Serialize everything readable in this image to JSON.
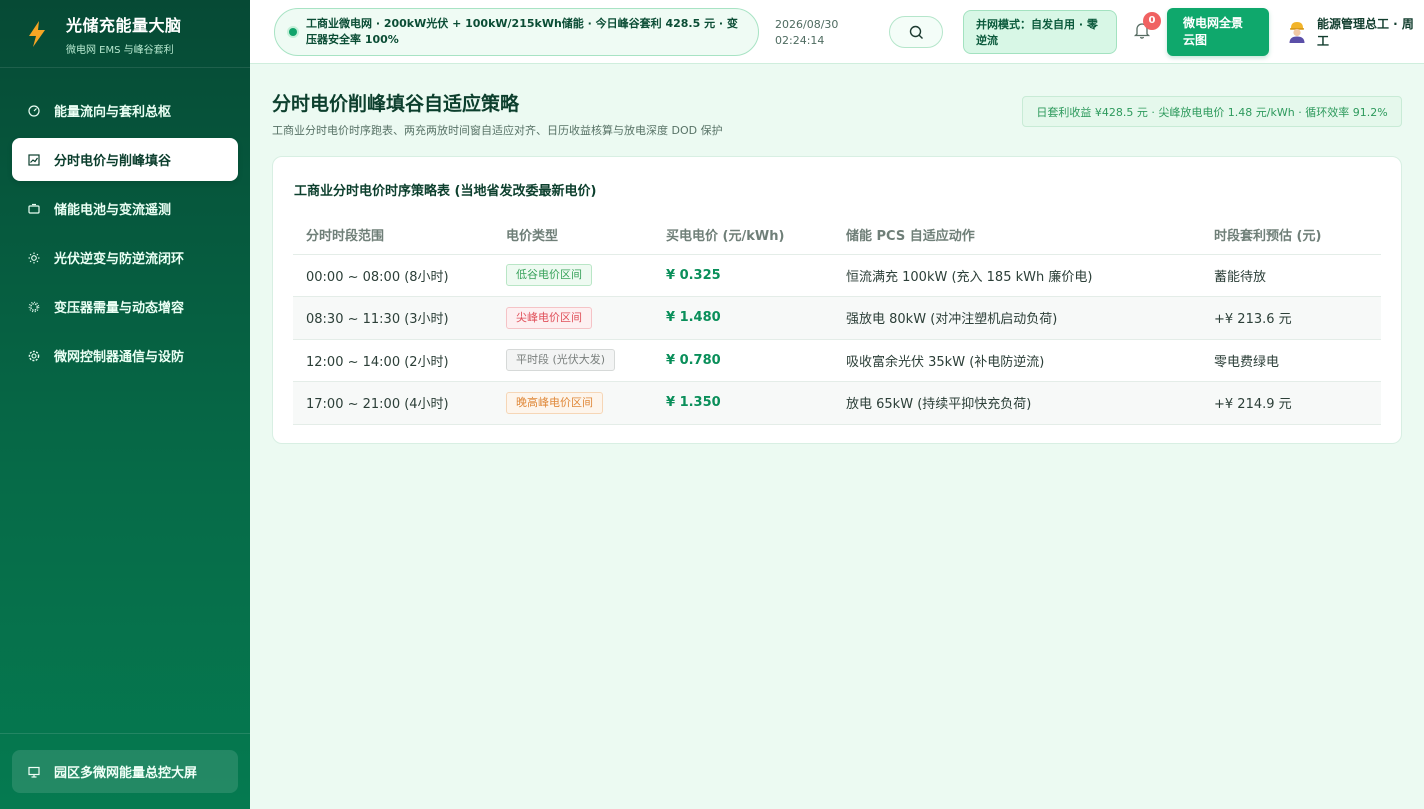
{
  "sidebar": {
    "brand_title": "光储充能量大脑",
    "brand_subtitle": "微电网 EMS 与峰谷套利",
    "items": [
      {
        "label": "能量流向与套利总枢",
        "icon": "gauge-icon",
        "active": false
      },
      {
        "label": "分时电价与削峰填谷",
        "icon": "chart-icon",
        "active": true
      },
      {
        "label": "储能电池与变流遥测",
        "icon": "battery-icon",
        "active": false
      },
      {
        "label": "光伏逆变与防逆流闭环",
        "icon": "sun-icon",
        "active": false
      },
      {
        "label": "变压器需量与动态增容",
        "icon": "cog-icon",
        "active": false
      },
      {
        "label": "微网控制器通信与设防",
        "icon": "gear-icon",
        "active": false
      }
    ],
    "bottom_button": "园区多微网能量总控大屏"
  },
  "header": {
    "ticker": "工商业微电网 · 200kW光伏 + 100kW/215kWh储能 · 今日峰谷套利 428.5 元 · 变压器安全率 100%",
    "date": "2026/08/30",
    "time": "02:24:14",
    "mode_badge": "并网模式：自发自用 · 零逆流",
    "notification_count": "0",
    "cloud_button": "微电网全景云图",
    "user_name": "能源管理总工 · 周工"
  },
  "page": {
    "title": "分时电价削峰填谷自适应策略",
    "subtitle": "工商业分时电价时序跑表、两充两放时间窗自适应对齐、日历收益核算与放电深度 DOD 保护",
    "kpi": "日套利收益 ¥428.5 元 · 尖峰放电电价 1.48 元/kWh · 循环效率 91.2%"
  },
  "table": {
    "title": "工商业分时电价时序策略表 (当地省发改委最新电价)",
    "columns": [
      "分时时段范围",
      "电价类型",
      "买电电价 (元/kWh)",
      "储能 PCS 自适应动作",
      "时段套利预估 (元)"
    ],
    "rows": [
      {
        "range": "00:00 ~ 08:00 (8小时)",
        "type": "低谷电价区间",
        "price": "¥ 0.325",
        "action": "恒流满充 100kW (充入 185 kWh 廉价电)",
        "estimate": "蓄能待放"
      },
      {
        "range": "08:30 ~ 11:30 (3小时)",
        "type": "尖峰电价区间",
        "price": "¥ 1.480",
        "action": "强放电 80kW (对冲注塑机启动负荷)",
        "estimate": "+¥ 213.6 元"
      },
      {
        "range": "12:00 ~ 14:00 (2小时)",
        "type": "平时段 (光伏大发)",
        "price": "¥ 0.780",
        "action": "吸收富余光伏 35kW (补电防逆流)",
        "estimate": "零电费绿电"
      },
      {
        "range": "17:00 ~ 21:00 (4小时)",
        "type": "晚高峰电价区间",
        "price": "¥ 1.350",
        "action": "放电 65kW (持续平抑快充负荷)",
        "estimate": "+¥ 214.9 元"
      }
    ]
  },
  "colors": {
    "accent": "#0fa86c",
    "tag_valley": "#3aa35c",
    "tag_peak": "#e0505a",
    "tag_flat": "#7a7f7d",
    "tag_evening": "#e0893a"
  }
}
